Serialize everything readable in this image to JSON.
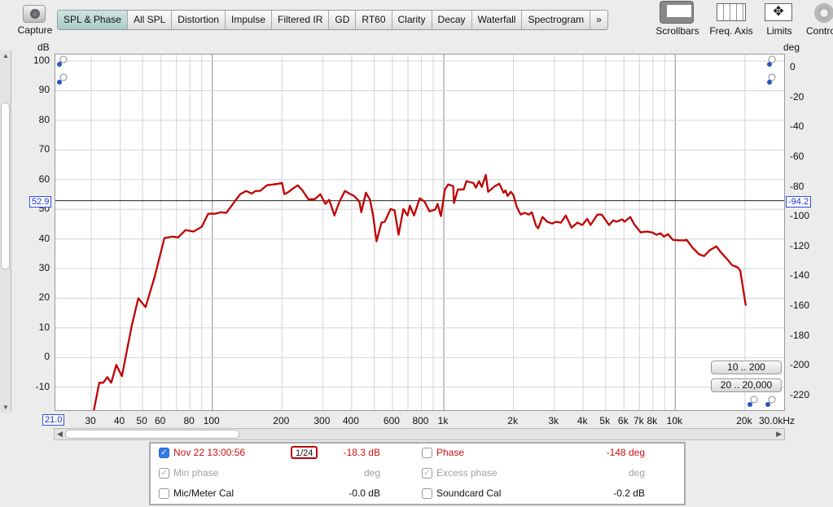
{
  "toolbar": {
    "capture_label": "Capture",
    "tabs": [
      {
        "label": "SPL & Phase",
        "active": true
      },
      {
        "label": "All SPL"
      },
      {
        "label": "Distortion"
      },
      {
        "label": "Impulse"
      },
      {
        "label": "Filtered IR"
      },
      {
        "label": "GD"
      },
      {
        "label": "RT60"
      },
      {
        "label": "Clarity"
      },
      {
        "label": "Decay"
      },
      {
        "label": "Waterfall"
      },
      {
        "label": "Spectrogram"
      },
      {
        "label": "»"
      }
    ],
    "right_tools": [
      {
        "label": "Scrollbars",
        "icon": "scrollbars-icon"
      },
      {
        "label": "Freq. Axis",
        "icon": "freq-axis-icon"
      },
      {
        "label": "Limits",
        "icon": "limits-icon"
      },
      {
        "label": "Controls",
        "icon": "gear-icon"
      }
    ]
  },
  "graph": {
    "left_unit": "dB",
    "right_unit": "deg",
    "cursor_left_value": "52.9",
    "cursor_right_value": "-94.2",
    "x_start_label": "21.0",
    "buttons": {
      "range1": "10 .. 200",
      "range2": "20 .. 20,000"
    }
  },
  "chart_data": {
    "type": "line",
    "x_scale": "log",
    "xlim": [
      21,
      30000
    ],
    "ylim": [
      -18.3,
      102.2
    ],
    "y2lim": [
      -231,
      8.8
    ],
    "grid": true,
    "xticks": [
      "30",
      "40",
      "50",
      "60",
      "80",
      "100",
      "200",
      "300",
      "400",
      "600",
      "800",
      "1k",
      "2k",
      "3k",
      "4k",
      "5k",
      "6k",
      "7k",
      "8k",
      "10k",
      "20k",
      "30.0kHz"
    ],
    "xtick_values": [
      30,
      40,
      50,
      60,
      80,
      100,
      200,
      300,
      400,
      600,
      800,
      1000,
      2000,
      3000,
      4000,
      5000,
      6000,
      7000,
      8000,
      10000,
      20000,
      30000
    ],
    "yticks": [
      "100",
      "90",
      "80",
      "70",
      "60",
      "50",
      "40",
      "30",
      "20",
      "10",
      "0",
      "-10"
    ],
    "ytick_values": [
      100,
      90,
      80,
      70,
      60,
      50,
      40,
      30,
      20,
      10,
      0,
      -10
    ],
    "y2ticks": [
      "0",
      "-20",
      "-40",
      "-60",
      "-80",
      "-100",
      "-120",
      "-140",
      "-160",
      "-180",
      "-200",
      "-220"
    ],
    "y2tick_values": [
      0,
      -20,
      -40,
      -60,
      -80,
      -100,
      -120,
      -140,
      -160,
      -180,
      -200,
      -220
    ],
    "cursor_db": 52.9,
    "series": [
      {
        "color": "#c00000",
        "freq": [
          30.7,
          32.5,
          33.8,
          35.2,
          36.6,
          38.5,
          40.7,
          44.9,
          47.9,
          51.5,
          56.3,
          62.1,
          67.3,
          71.2,
          76.6,
          83,
          90,
          96,
          103,
          109,
          115,
          124,
          132,
          140,
          148,
          154,
          161,
          172,
          193,
          200,
          205,
          214,
          223,
          234,
          245,
          260,
          277,
          293,
          308,
          320,
          337,
          353,
          374,
          391,
          410,
          432,
          440,
          461,
          480,
          495,
          512,
          538,
          556,
          589,
          613,
          638,
          669,
          697,
          714,
          744,
          787,
          826,
          867,
          918,
          940,
          972,
          1011,
          1045,
          1098,
          1106,
          1150,
          1219,
          1252,
          1292,
          1342,
          1376,
          1420,
          1459,
          1519,
          1555,
          1661,
          1739,
          1812,
          1845,
          1887,
          1948,
          1998,
          2063,
          2147,
          2237,
          2327,
          2402,
          2504,
          2558,
          2667,
          2798,
          2935,
          3058,
          3207,
          3364,
          3563,
          3776,
          3969,
          4165,
          4303,
          4606,
          4811,
          5176,
          5391,
          5560,
          5894,
          6036,
          6388,
          6649,
          7092,
          7506,
          7948,
          8283,
          8630,
          8921,
          9300,
          9758,
          10332,
          10934,
          11200,
          11874,
          12670,
          13310,
          14100,
          15050,
          15680,
          16870,
          17570,
          18600,
          19070,
          20150
        ],
        "spl": [
          -18.3,
          -8.5,
          -8.5,
          -6.6,
          -8.5,
          -2.5,
          -6.3,
          10.7,
          20.0,
          17.0,
          27.1,
          40.3,
          40.8,
          40.5,
          43.0,
          42.5,
          44.1,
          48.5,
          48.5,
          49.0,
          48.8,
          52.3,
          55.1,
          56.2,
          55.3,
          56.2,
          56.2,
          58.1,
          58.6,
          58.9,
          55.1,
          55.9,
          57.0,
          58.1,
          56.4,
          53.4,
          53.4,
          55.1,
          51.8,
          53.2,
          47.9,
          52.3,
          56.2,
          55.3,
          54.5,
          52.6,
          49.0,
          55.6,
          53.2,
          47.9,
          39.2,
          45.5,
          45.8,
          50.1,
          49.6,
          41.4,
          50.1,
          47.9,
          51.2,
          47.9,
          53.7,
          52.6,
          49.3,
          49.9,
          51.8,
          47.7,
          56.7,
          58.4,
          57.8,
          52.1,
          56.7,
          56.7,
          59.5,
          59.2,
          58.9,
          57.3,
          59.5,
          57.5,
          61.6,
          55.9,
          57.8,
          58.6,
          55.6,
          56.4,
          54.5,
          55.9,
          54.8,
          51.0,
          48.2,
          48.8,
          48.2,
          49.0,
          44.4,
          43.6,
          47.4,
          45.8,
          45.2,
          45.8,
          45.5,
          47.9,
          43.8,
          45.5,
          44.7,
          46.8,
          44.7,
          48.2,
          48.2,
          44.7,
          46.3,
          45.8,
          46.6,
          45.8,
          47.4,
          44.9,
          42.2,
          42.5,
          42.2,
          41.4,
          41.9,
          40.8,
          41.6,
          39.7,
          39.5,
          39.5,
          39.7,
          37.0,
          34.8,
          34.2,
          36.2,
          37.5,
          35.6,
          32.9,
          31.2,
          30.4,
          29.3,
          17.5
        ]
      }
    ]
  },
  "legend": {
    "measurement": {
      "label": "Nov 22 13:00:56",
      "checked": true,
      "smoothing": "1/24",
      "value": "-18.3 dB"
    },
    "phase": {
      "label": "Phase",
      "checked": false,
      "value": "-148 deg"
    },
    "min_phase": {
      "label": "Min phase",
      "checked": true,
      "value": "deg"
    },
    "excess_phase": {
      "label": "Excess phase",
      "checked": true,
      "value": "deg"
    },
    "mic_cal": {
      "label": "Mic/Meter Cal",
      "checked": false,
      "value": "-0.0 dB"
    },
    "soundcard_cal": {
      "label": "Soundcard Cal",
      "checked": false,
      "value": "-0.2 dB"
    }
  }
}
